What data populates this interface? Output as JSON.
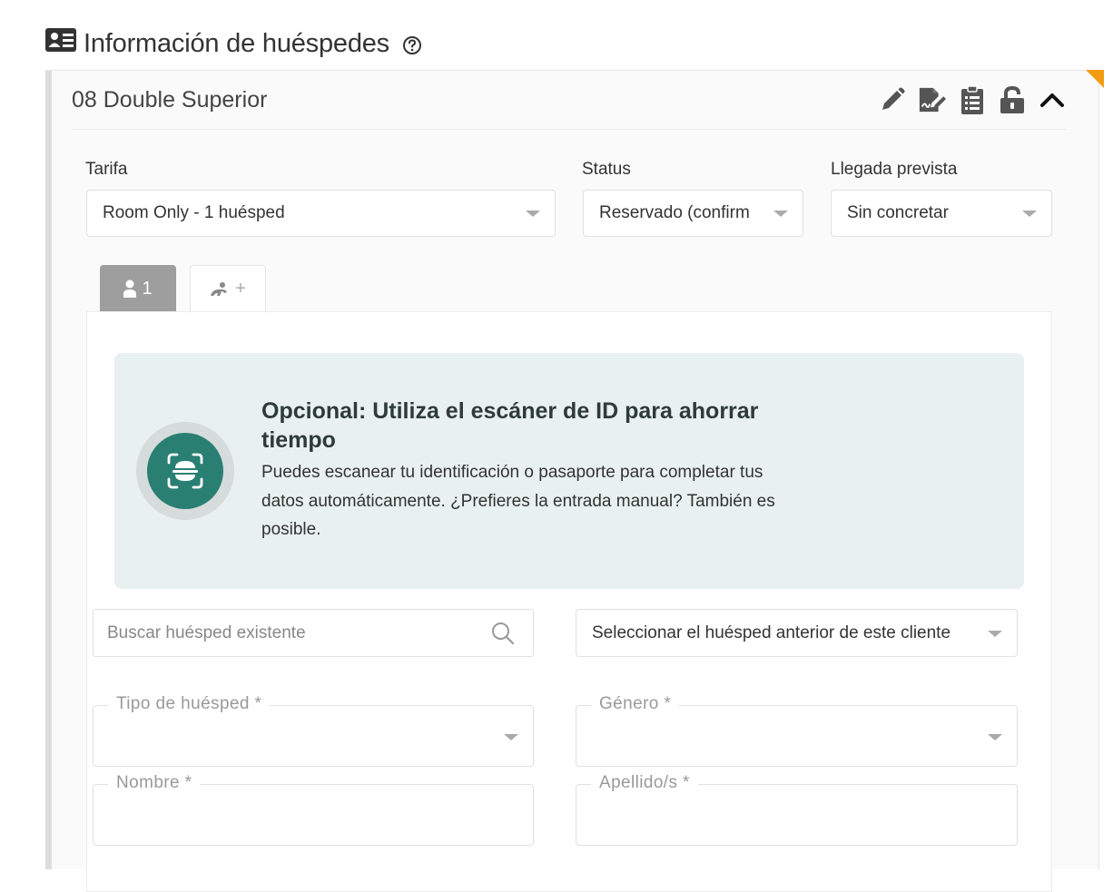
{
  "section": {
    "title": "Información de huéspedes"
  },
  "room": {
    "name": "08 Double Superior",
    "actions": [
      "pencil-icon",
      "signature-icon",
      "clipboard-list-icon",
      "unlock-icon",
      "chevron-up-icon"
    ]
  },
  "fields": {
    "tarifa": {
      "label": "Tarifa",
      "value": "Room Only - 1 huésped"
    },
    "status": {
      "label": "Status",
      "value": "Reservado (confirm"
    },
    "llegada": {
      "label": "Llegada prevista",
      "value": "Sin concretar"
    }
  },
  "tabs": {
    "guest1": {
      "label": "1"
    },
    "add": {
      "label": "+"
    }
  },
  "scanner": {
    "title": "Opcional: Utiliza el escáner de ID para ahorrar tiempo",
    "description": "Puedes escanear tu identificación o pasaporte para completar tus datos automáticamente. ¿Prefieres la entrada manual? También es posible."
  },
  "search": {
    "placeholder": "Buscar huésped existente"
  },
  "previous_guest": {
    "value": "Seleccionar el huésped anterior de este cliente"
  },
  "form": {
    "tipo": {
      "label": "Tipo de huésped *"
    },
    "genero": {
      "label": "Género *"
    },
    "nombre": {
      "label": "Nombre *"
    },
    "apellidos": {
      "label": "Apellido/s *"
    }
  },
  "colors": {
    "accent": "#2a7f73",
    "banner_bg": "#e8f1ef",
    "corner_flag": "#f39c12",
    "active_tab": "#9e9e9e"
  }
}
